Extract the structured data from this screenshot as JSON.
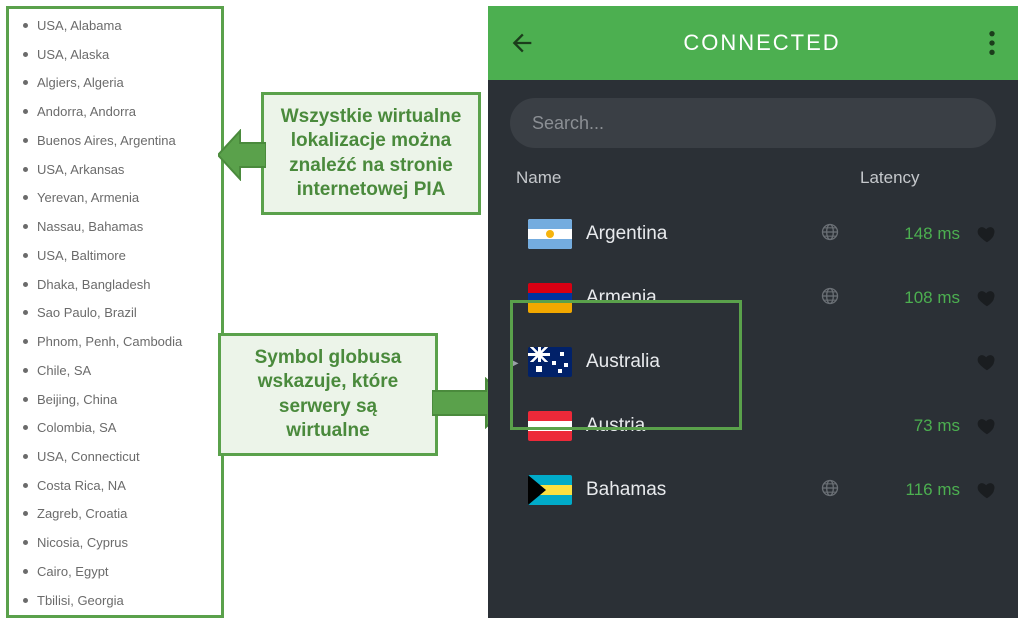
{
  "left_list": [
    "USA, Alabama",
    "USA, Alaska",
    "Algiers, Algeria",
    "Andorra, Andorra",
    "Buenos Aires, Argentina",
    "USA, Arkansas",
    "Yerevan, Armenia",
    "Nassau, Bahamas",
    "USA, Baltimore",
    "Dhaka, Bangladesh",
    "Sao Paulo, Brazil",
    "Phnom, Penh, Cambodia",
    "Chile, SA",
    "Beijing, China",
    "Colombia, SA",
    "USA, Connecticut",
    "Costa Rica, NA",
    "Zagreb, Croatia",
    "Nicosia, Cyprus",
    "Cairo, Egypt",
    "Tbilisi, Georgia"
  ],
  "callouts": {
    "top": "Wszystkie wirtualne lokalizacje można znaleźć na stronie internetowej PIA",
    "bottom": "Symbol globusa wskazuje, które serwery są wirtualne"
  },
  "app": {
    "status": "CONNECTED",
    "search_placeholder": "Search...",
    "columns": {
      "name": "Name",
      "latency": "Latency"
    },
    "servers": [
      {
        "name": "Argentina",
        "latency": "148 ms",
        "virtual": true,
        "flag": "ar",
        "expandable": false
      },
      {
        "name": "Armenia",
        "latency": "108 ms",
        "virtual": true,
        "flag": "am",
        "expandable": false
      },
      {
        "name": "Australia",
        "latency": "",
        "virtual": false,
        "flag": "au",
        "expandable": true
      },
      {
        "name": "Austria",
        "latency": "73 ms",
        "virtual": false,
        "flag": "at",
        "expandable": false
      },
      {
        "name": "Bahamas",
        "latency": "116 ms",
        "virtual": true,
        "flag": "bs",
        "expandable": false
      }
    ]
  }
}
